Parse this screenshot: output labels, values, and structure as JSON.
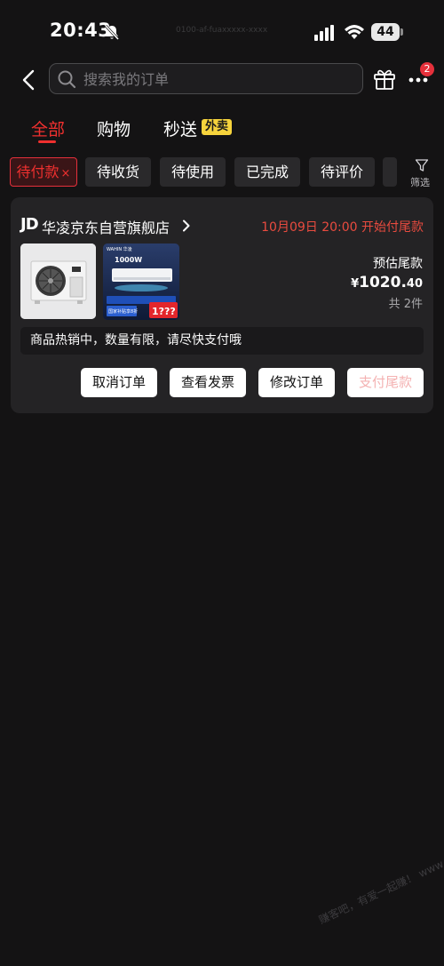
{
  "status_bar": {
    "time": "20:43",
    "battery": "44",
    "watermark": "0100-af-fuaxxxxx-xxxx"
  },
  "header": {
    "search_placeholder": "搜索我的订单",
    "more_badge": "2"
  },
  "tabs": {
    "all": "全部",
    "shopping": "购物",
    "flash": "秒送",
    "takeout_badge": "外卖"
  },
  "filters": {
    "active": "待付款",
    "active_close": "×",
    "items": [
      "待收货",
      "待使用",
      "已完成",
      "待评价"
    ],
    "filter_label": "筛选"
  },
  "order": {
    "store_logo": "JD",
    "store_name": "华凌京东自营旗舰店",
    "status": "10月09日 20:00 开始付尾款",
    "price_label": "预估尾款",
    "price_currency": "¥",
    "price_int": "1020.",
    "price_dec": "40",
    "item_count": "共 2件",
    "notice": "商品热销中，数量有限，请尽快支付哦",
    "buttons": {
      "cancel": "取消订单",
      "invoice": "查看发票",
      "modify": "修改订单",
      "pay": "支付尾款"
    },
    "product2_texts": {
      "brand": "WAHIN 华凌",
      "headline": "1000W",
      "promo": "国家补贴享8折",
      "price_tag": "1???"
    }
  },
  "watermark_bottom": "赚客吧，有爱一起赚！ www.zuanke8.com",
  "colors": {
    "accent": "#f0302f",
    "badge_yellow": "#f6d33c",
    "card_bg": "#242325",
    "page_bg": "#141314"
  }
}
